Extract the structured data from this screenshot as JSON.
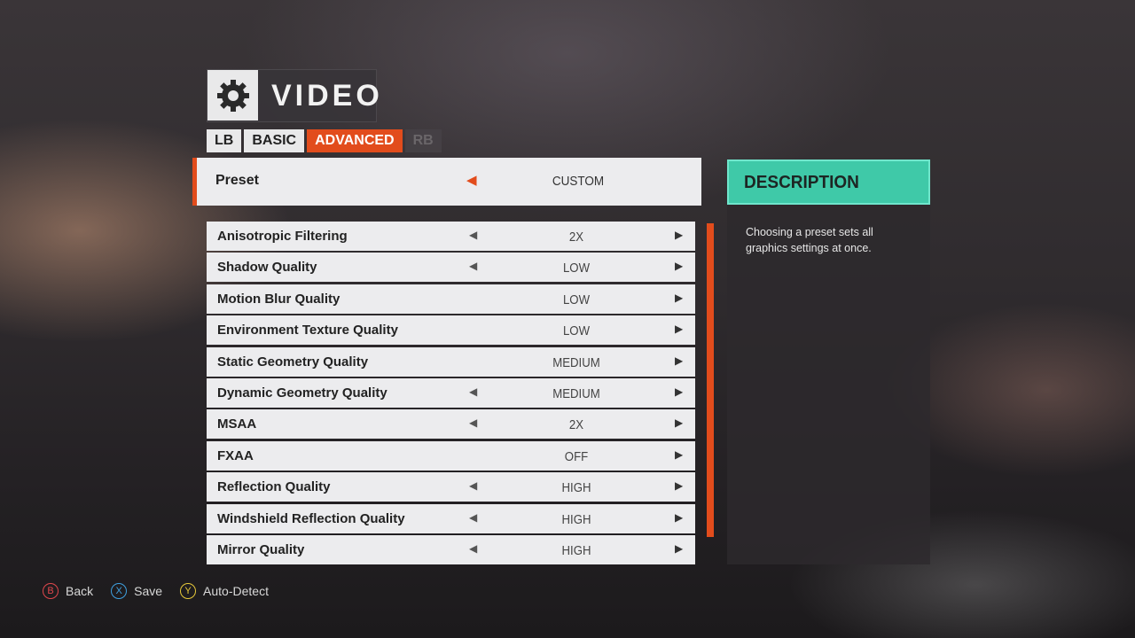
{
  "header": {
    "title": "VIDEO",
    "icon": "gear-icon"
  },
  "tabs": [
    {
      "label": "LB"
    },
    {
      "label": "BASIC"
    },
    {
      "label": "ADVANCED",
      "active": true
    },
    {
      "label": "RB"
    }
  ],
  "preset": {
    "label": "Preset",
    "value": "CUSTOM"
  },
  "settings": [
    {
      "label": "Anisotropic Filtering",
      "value": "2X"
    },
    {
      "label": "Shadow Quality",
      "value": "LOW"
    },
    {
      "label": "Motion Blur Quality",
      "value": "LOW"
    },
    {
      "label": "Environment Texture Quality",
      "value": "LOW"
    },
    {
      "label": "Static Geometry Quality",
      "value": "MEDIUM"
    },
    {
      "label": "Dynamic Geometry Quality",
      "value": "MEDIUM"
    },
    {
      "label": "MSAA",
      "value": "2X"
    },
    {
      "label": "FXAA",
      "value": "OFF"
    },
    {
      "label": "Reflection Quality",
      "value": "HIGH"
    },
    {
      "label": "Windshield Reflection Quality",
      "value": "HIGH"
    },
    {
      "label": "Mirror Quality",
      "value": "HIGH"
    }
  ],
  "description": {
    "title": "DESCRIPTION",
    "text": "Choosing a preset sets all graphics settings at once."
  },
  "footer": [
    {
      "button": "B",
      "label": "Back",
      "color": "#e0474c"
    },
    {
      "button": "X",
      "label": "Save",
      "color": "#3fa0e0"
    },
    {
      "button": "Y",
      "label": "Auto-Detect",
      "color": "#e6c83a"
    }
  ],
  "colors": {
    "accent": "#e24c1c",
    "description": "#3fc9a8"
  }
}
